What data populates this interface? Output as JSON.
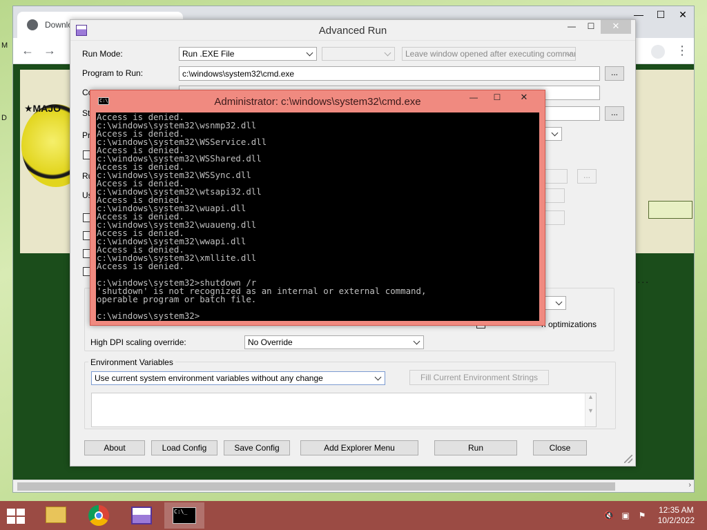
{
  "browser": {
    "tab_title": "Downlo",
    "tab_close": "✕",
    "win_min": "—",
    "win_max": "☐",
    "win_close": "✕",
    "back": "←",
    "forward": "→",
    "logo_text": "★MAJO",
    "dots": "....",
    "scroll_right": "›"
  },
  "advrun": {
    "title": "Advanced Run",
    "ctrl_min": "—",
    "ctrl_max": "☐",
    "ctrl_close": "✕",
    "run_mode_label": "Run Mode:",
    "run_mode_value": "Run .EXE File",
    "leave_window_value": "Leave window opened after executing command",
    "program_label": "Program to Run:",
    "program_value": "c:\\windows\\system32\\cmd.exe",
    "browse": "...",
    "partial_label_co": "Co",
    "partial_label_st": "St",
    "partial_label_pr": "Pr",
    "partial_label_ru": "Ru",
    "partial_label_us": "Us",
    "optimizations_label": "n optimizations",
    "high_dpi_label": "High DPI scaling override:",
    "high_dpi_value": "No Override",
    "env_group_label": "Environment Variables",
    "env_value": "Use current system environment variables without any change",
    "fill_env_button": "Fill Current Environment Strings",
    "buttons": {
      "about": "About",
      "load_config": "Load Config",
      "save_config": "Save Config",
      "add_explorer_menu": "Add Explorer Menu",
      "run": "Run",
      "close": "Close"
    }
  },
  "cmd": {
    "title": "Administrator: c:\\windows\\system32\\cmd.exe",
    "icon_text": "C:\\",
    "ctrl_min": "—",
    "ctrl_max": "☐",
    "ctrl_close": "✕",
    "console_text": "Access is denied.\nc:\\windows\\system32\\wsnmp32.dll\nAccess is denied.\nc:\\windows\\system32\\WSService.dll\nAccess is denied.\nc:\\windows\\system32\\WSShared.dll\nAccess is denied.\nc:\\windows\\system32\\WSSync.dll\nAccess is denied.\nc:\\windows\\system32\\wtsapi32.dll\nAccess is denied.\nc:\\windows\\system32\\wuapi.dll\nAccess is denied.\nc:\\windows\\system32\\wuaueng.dll\nAccess is denied.\nc:\\windows\\system32\\wwapi.dll\nAccess is denied.\nc:\\windows\\system32\\xmllite.dll\nAccess is denied.\n\nc:\\windows\\system32>shutdown /r\n'shutdown' is not recognized as an internal or external command,\noperable program or batch file.\n\nc:\\windows\\system32>"
  },
  "taskbar": {
    "time": "12:35 AM",
    "date": "10/2/2022",
    "colors": {
      "bar": "#9b4b44",
      "cmd_frame": "#f08a80"
    }
  },
  "desktop": {
    "scrap_m": "M",
    "scrap_d": "D"
  }
}
